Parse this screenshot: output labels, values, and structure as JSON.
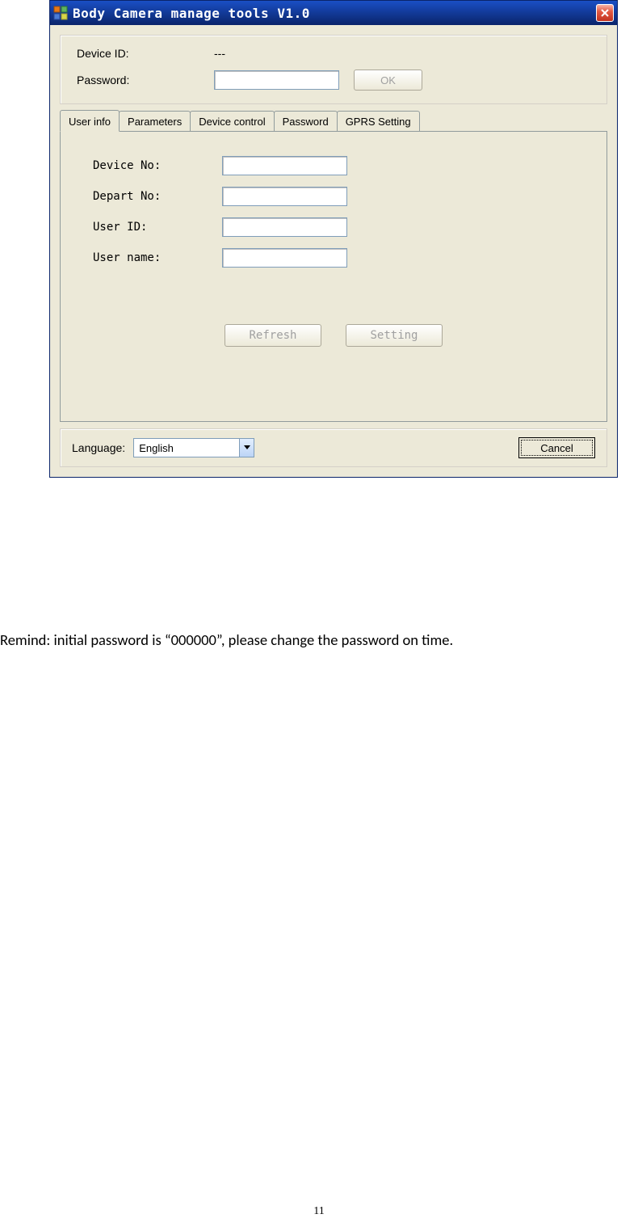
{
  "window": {
    "title": "Body Camera manage tools V1.0",
    "top": {
      "device_id_label": "Device ID:",
      "device_id_value": "---",
      "password_label": "Password:",
      "password_value": "",
      "ok_button": "OK"
    },
    "tabs": [
      {
        "label": "User info"
      },
      {
        "label": "Parameters"
      },
      {
        "label": "Device control"
      },
      {
        "label": "Password"
      },
      {
        "label": "GPRS Setting"
      }
    ],
    "user_info_panel": {
      "device_no_label": "Device No:",
      "device_no_value": "",
      "depart_no_label": "Depart No:",
      "depart_no_value": "",
      "user_id_label": "User ID:",
      "user_id_value": "",
      "user_name_label": "User name:",
      "user_name_value": "",
      "refresh_button": "Refresh",
      "setting_button": "Setting"
    },
    "footer": {
      "language_label": "Language:",
      "language_value": "English",
      "cancel_button": "Cancel"
    }
  },
  "remind_text": "Remind: initial password is “000000”, please change the password on time.",
  "page_number": "11"
}
